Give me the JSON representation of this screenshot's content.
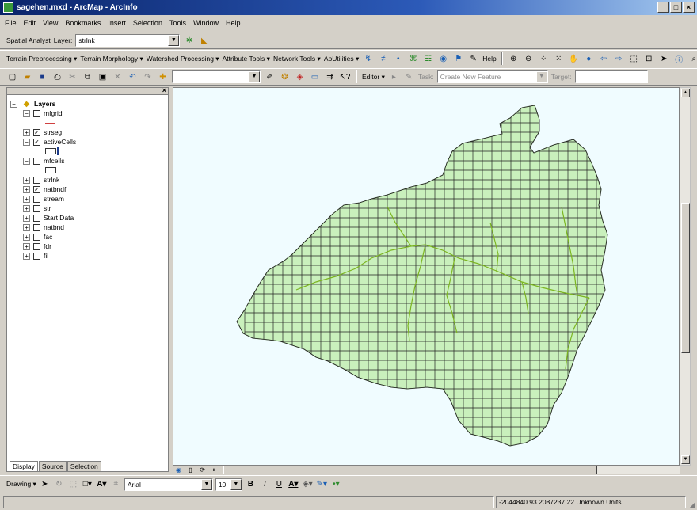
{
  "window": {
    "title": "sagehen.mxd - ArcMap - ArcInfo"
  },
  "menu": [
    "File",
    "Edit",
    "View",
    "Bookmarks",
    "Insert",
    "Selection",
    "Tools",
    "Window",
    "Help"
  ],
  "spatial_toolbar": {
    "spatial_analyst": "Spatial Analyst",
    "layer_label": "Layer:",
    "layer_value": "strlnk"
  },
  "arc_hydro_toolbar": {
    "menus": [
      "Terrain Preprocessing",
      "Terrain Morphology",
      "Watershed Processing",
      "Attribute Tools",
      "Network Tools",
      "ApUtilities"
    ],
    "help": "Help"
  },
  "editor_toolbar": {
    "editor": "Editor",
    "task_label": "Task:",
    "task_value": "Create New Feature",
    "target_label": "Target:"
  },
  "toc": {
    "root": "Layers",
    "layers": [
      {
        "name": "mfgrid",
        "checked": false,
        "expanded": true
      },
      {
        "name": "strseg",
        "checked": true,
        "expanded": false
      },
      {
        "name": "activeCells",
        "checked": true,
        "expanded": true
      },
      {
        "name": "mfcells",
        "checked": false,
        "expanded": true
      },
      {
        "name": "strlnk",
        "checked": false,
        "expanded": false
      },
      {
        "name": "natbndf",
        "checked": true,
        "expanded": false
      },
      {
        "name": "stream",
        "checked": false,
        "expanded": false
      },
      {
        "name": "str",
        "checked": false,
        "expanded": false
      },
      {
        "name": "Start Data",
        "checked": false,
        "expanded": false
      },
      {
        "name": "natbnd",
        "checked": false,
        "expanded": false
      },
      {
        "name": "fac",
        "checked": false,
        "expanded": false
      },
      {
        "name": "fdr",
        "checked": false,
        "expanded": false
      },
      {
        "name": "fil",
        "checked": false,
        "expanded": false
      }
    ],
    "tabs": [
      "Display",
      "Source",
      "Selection"
    ]
  },
  "drawing_toolbar": {
    "drawing": "Drawing",
    "font": "Arial",
    "size": "10"
  },
  "status": {
    "coords": "-2044840.93  2087237.22 Unknown Units"
  },
  "colors": {
    "watershed_fill": "#c9f0bc",
    "grid_line": "#222222",
    "stream": "#7cb520",
    "map_bg": "#f0fcff"
  }
}
